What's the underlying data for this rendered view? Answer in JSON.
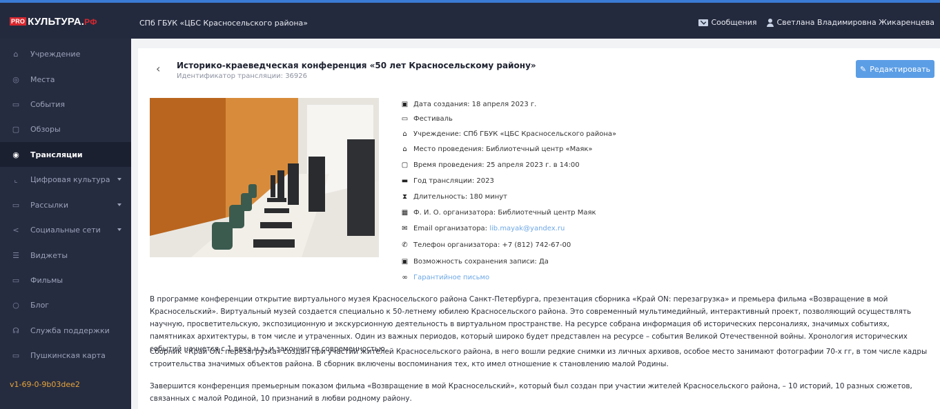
{
  "header": {
    "logo_pro": "PRO",
    "logo_text": "КУЛЬТУРА.",
    "logo_rf": "РФ",
    "organization": "СПб ГБУК «ЦБС Красносельского района»",
    "messages_label": "Сообщения",
    "user_name": "Светлана Владимировна Жикаренцева"
  },
  "sidebar": {
    "items": [
      {
        "label": "Учреждение",
        "icon": "home-icon"
      },
      {
        "label": "Места",
        "icon": "location-icon"
      },
      {
        "label": "События",
        "icon": "calendar-icon"
      },
      {
        "label": "Обзоры",
        "icon": "document-icon"
      },
      {
        "label": "Трансляции",
        "icon": "broadcast-icon",
        "active": true
      },
      {
        "label": "Цифровая культура",
        "icon": "digital-icon",
        "has_submenu": true
      },
      {
        "label": "Рассылки",
        "icon": "mailing-icon",
        "has_submenu": true
      },
      {
        "label": "Социальные сети",
        "icon": "share-icon",
        "has_submenu": true
      },
      {
        "label": "Виджеты",
        "icon": "widget-icon"
      },
      {
        "label": "Фильмы",
        "icon": "film-icon"
      },
      {
        "label": "Блог",
        "icon": "blog-icon"
      },
      {
        "label": "Служба поддержки",
        "icon": "support-icon"
      },
      {
        "label": "Пушкинская карта",
        "icon": "card-icon"
      }
    ],
    "version": "v1-69-0-9b03dee2"
  },
  "broadcast": {
    "back_symbol": "‹",
    "title": "Историко-краеведческая конференция «50 лет Красносельскому району»",
    "id_line": "Идентификатор трансляции: 36926",
    "edit_button": "Редактировать"
  },
  "details": [
    {
      "icon": "calendar-icon",
      "text": "Дата создания: 18 апреля 2023 г."
    },
    {
      "icon": "folder-icon",
      "text": "Фестиваль"
    },
    {
      "icon": "home-icon",
      "text": "Учреждение: СПб ГБУК «ЦБС Красносельского района»"
    },
    {
      "icon": "home-icon",
      "text": "Место проведения: Библиотечный центр «Маяк»"
    },
    {
      "icon": "calendar-outline-icon",
      "text": "Время проведения: 25 апреля 2023 г. в 14:00"
    },
    {
      "icon": "calendar-filled-icon",
      "text": "Год трансляции: 2023"
    },
    {
      "icon": "hourglass-icon",
      "text": "Длительность: 180 минут"
    },
    {
      "icon": "id-card-icon",
      "text": "Ф. И. О. организатора: Библиотечный центр Маяк"
    },
    {
      "icon": "envelope-icon",
      "text": "Email организатора:",
      "link": "lib.mayak@yandex.ru"
    },
    {
      "icon": "phone-icon",
      "text": "Телефон организатора: +7 (812) 742-67-00"
    },
    {
      "icon": "save-icon",
      "text": "Возможность сохранения записи: Да"
    },
    {
      "icon": "link-icon",
      "link": "Гарантийное письмо"
    }
  ],
  "description": [
    "В программе конференции открытие виртуального музея Красносельского района Санкт-Петербурга, презентация сборника «Край ON: перезагрузка» и премьера фильма «Возвращение в мой Красносельский». Виртуальный музей создается специально к 50-летнему юбилею Красносельского района. Это современный мультимедийный, интерактивный проект, позволяющий осуществлять научную, просветительскую, экспозиционную и экскурсионную деятельность в виртуальном пространстве. На ресурсе собрана информация об исторических персоналиях, значимых событиях, памятниках архитектуры, в том числе и утраченных. Один из важных периодов, который широко будет представлен на ресурсе – события Великой Отечественной войны. Хронология исторических событий начнется с 1 века н.э. и закончится современностью.",
    "Сборник «Край ON: перезагрузка» создан при участии жителей Красносельского района, в него вошли редкие снимки из личных архивов, особое место занимают фотографии 70-х гг, в том числе кадры строительства значимых объектов района. В сборник включены воспоминания тех, кто имел отношение к становлению малой Родины.",
    "Завершится конференция премьерным показом фильма «Возвращение в мой Красносельский», который был создан при участии жителей Красносельского района, – 10 историй, 10 разных сюжетов, связанных с малой Родиной, 10 признаний в любви родному району."
  ]
}
